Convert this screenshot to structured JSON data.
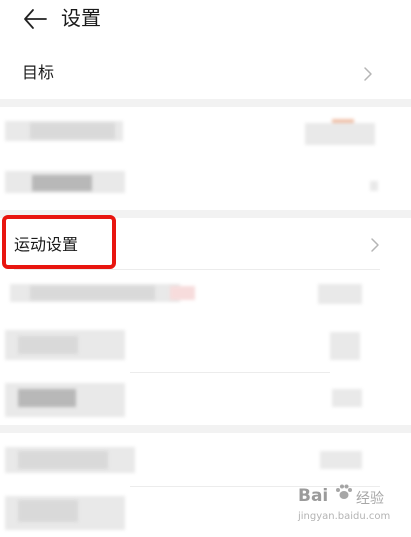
{
  "header": {
    "title": "设置",
    "back_icon": "arrow-left-icon"
  },
  "rows": {
    "target": {
      "label": "目标",
      "chevron_icon": "chevron-right-icon"
    },
    "sport_settings": {
      "label": "运动设置",
      "chevron_icon": "chevron-right-icon"
    }
  },
  "annotation": {
    "highlight_color": "#e8150f"
  },
  "watermark": {
    "brand": "Bai",
    "text": "经验",
    "url": "jingyan.baidu.com"
  }
}
